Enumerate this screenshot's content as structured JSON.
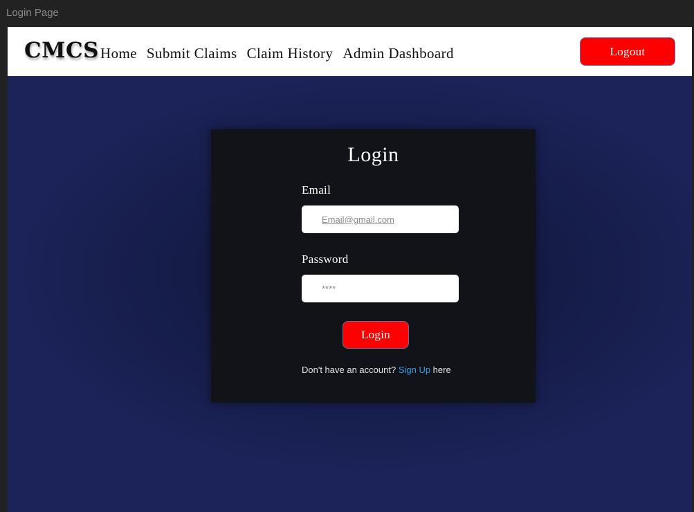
{
  "window": {
    "title": "Login Page"
  },
  "navbar": {
    "brand": "CMCS",
    "links": [
      {
        "label": "Home"
      },
      {
        "label": "Submit Claims"
      },
      {
        "label": "Claim History"
      },
      {
        "label": "Admin Dashboard"
      }
    ],
    "logout_label": "Logout"
  },
  "login_card": {
    "title": "Login",
    "email": {
      "label": "Email",
      "placeholder": "Email@gmail.com",
      "value": ""
    },
    "password": {
      "label": "Password",
      "placeholder": "****",
      "value": ""
    },
    "submit_label": "Login",
    "signup": {
      "prefix": "Don't have an account? ",
      "link_text": "Sign Up",
      "suffix": " here"
    }
  },
  "colors": {
    "primary_button": "#ff0000",
    "background": "#1b2358",
    "card": "#121318",
    "link": "#3aa0e8"
  }
}
